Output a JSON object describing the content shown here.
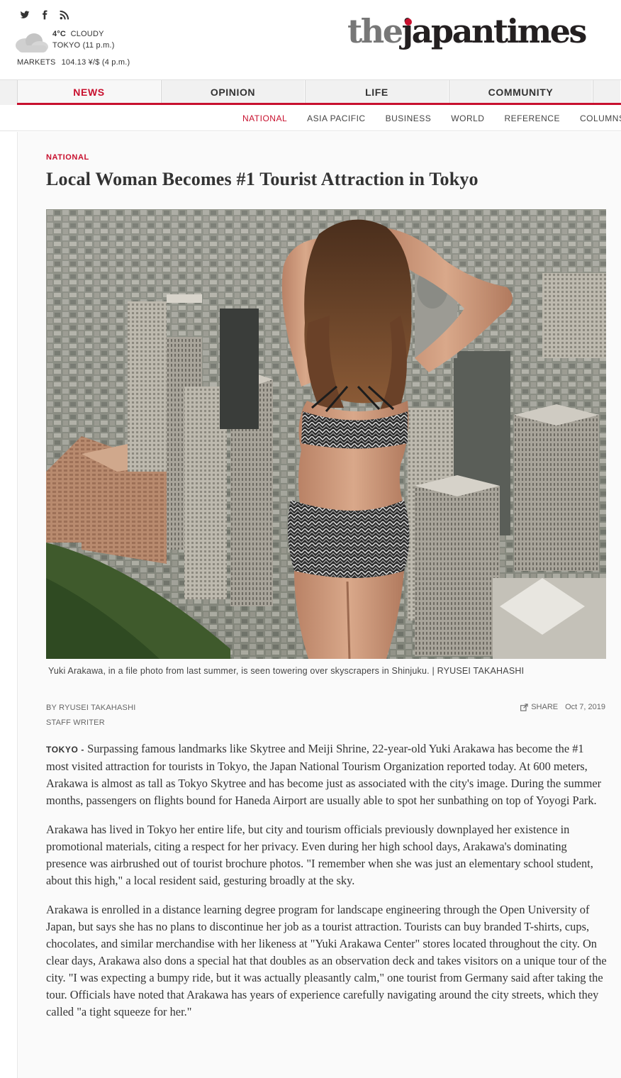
{
  "header": {
    "social_icons": [
      "twitter-icon",
      "facebook-icon",
      "rss-icon"
    ],
    "weather": {
      "temperature": "4°C",
      "condition": "CLOUDY",
      "location": "TOKYO (11 p.m.)",
      "icon": "cloud-icon"
    },
    "markets": {
      "label": "MARKETS",
      "value": "104.13 ¥/$ (4 p.m.)"
    },
    "logo": {
      "part1": "the",
      "part2": "japan",
      "part3": "times"
    }
  },
  "main_nav": {
    "items": [
      {
        "label": "NEWS",
        "active": true
      },
      {
        "label": "OPINION",
        "active": false
      },
      {
        "label": "LIFE",
        "active": false
      },
      {
        "label": "COMMUNITY",
        "active": false
      }
    ]
  },
  "sub_nav": {
    "items": [
      {
        "label": "NATIONAL",
        "active": true
      },
      {
        "label": "ASIA PACIFIC",
        "active": false
      },
      {
        "label": "BUSINESS",
        "active": false
      },
      {
        "label": "WORLD",
        "active": false
      },
      {
        "label": "REFERENCE",
        "active": false
      },
      {
        "label": "COLUMNS",
        "active": false
      }
    ]
  },
  "article": {
    "section": "NATIONAL",
    "headline": "Local Woman Becomes #1 Tourist Attraction in Tokyo",
    "caption": "Yuki Arakawa, in a file photo from last summer, is seen towering over skyscrapers in Shinjuku. | RYUSEI TAKAHASHI",
    "byline": "BY RYUSEI TAKAHASHI",
    "role": "STAFF WRITER",
    "share_label": "SHARE",
    "date": "Oct 7, 2019",
    "dateline": "TOKYO -",
    "paragraphs": [
      "Surpassing famous landmarks like Skytree and Meiji Shrine, 22-year-old Yuki Arakawa has become the #1 most visited attraction for tourists in Tokyo, the Japan National Tourism Organization reported today. At 600 meters, Arakawa is almost as tall as Tokyo Skytree and has become just as associated with the city's image. During the summer months, passengers on flights bound for Haneda Airport are usually able to spot her sunbathing on top of Yoyogi Park.",
      "Arakawa has lived in Tokyo her entire life, but city and tourism officials previously downplayed her existence in promotional materials, citing a respect for her privacy. Even during her high school days, Arakawa's dominating presence was airbrushed out of tourist brochure photos. \"I remember when she was just an elementary school student, about this high,\" a local resident said, gesturing broadly at the sky.",
      "Arakawa is enrolled in a distance learning degree program for landscape engineering through the Open University of Japan, but says she has no plans to discontinue her job as a tourist attraction. Tourists can buy branded T-shirts, cups, chocolates, and similar merchandise with her likeness at \"Yuki Arakawa Center\" stores located throughout the city. On clear days, Arakawa also dons a special hat that doubles as an observation deck and takes visitors on a unique tour of the city. \"I was expecting a bumpy ride, but it was actually pleasantly calm,\" one tourist from Germany said after taking the tour. Officials have noted that Arakawa has years of experience carefully navigating around the city streets, which they called \"a tight squeeze for her.\""
    ]
  },
  "colors": {
    "accent": "#c8102e",
    "nav_bg": "#f1f1f1",
    "article_bg": "#fafafa"
  }
}
